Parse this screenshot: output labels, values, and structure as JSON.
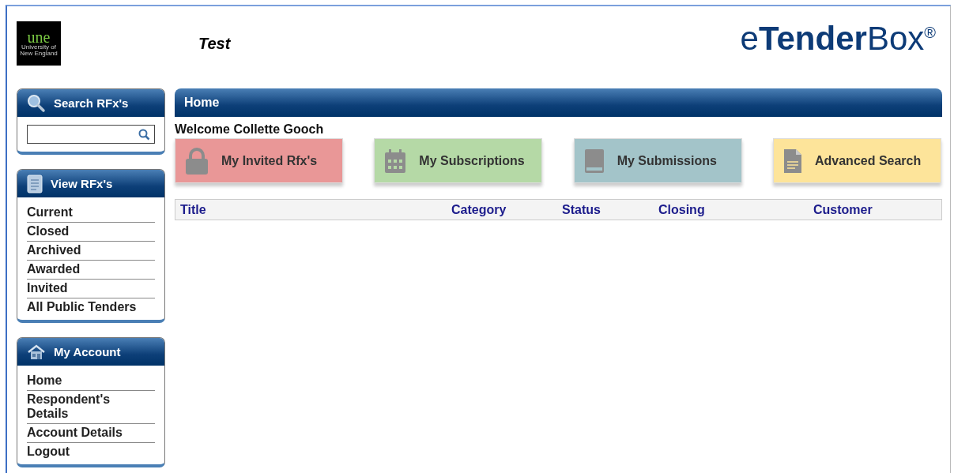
{
  "header": {
    "logo": {
      "mark": "une",
      "caption": "University of New England"
    },
    "title": "Test",
    "brand": "e**Tender**Box$^{®}$"
  },
  "sidebar": {
    "panels": [
      {
        "kind": "search",
        "title": "Search RFx's"
      },
      {
        "kind": "list",
        "title": "View RFx's",
        "items": [
          "Current",
          "Closed",
          "Archived",
          "Awarded",
          "Invited",
          "All Public Tenders"
        ]
      },
      {
        "kind": "account",
        "title": "My Account",
        "items": [
          "Home",
          "Respondent's Details",
          "Account Details",
          "Logout"
        ]
      }
    ]
  },
  "main": {
    "title": "Home",
    "welcome": "Welcome Collette Gooch",
    "tiles": [
      {
        "kind": "lock",
        "label": "My Invited Rfx's",
        "color": "#e99797"
      },
      {
        "kind": "calendar",
        "label": "My Subscriptions",
        "color": "#b5d9a6"
      },
      {
        "kind": "book",
        "label": "My Submissions",
        "color": "#a3c4c9"
      },
      {
        "kind": "document",
        "label": "Advanced Search",
        "color": "#fde49a"
      }
    ],
    "table": {
      "columns": [
        "Title",
        "Category",
        "Status",
        "Closing",
        "Customer"
      ]
    }
  }
}
